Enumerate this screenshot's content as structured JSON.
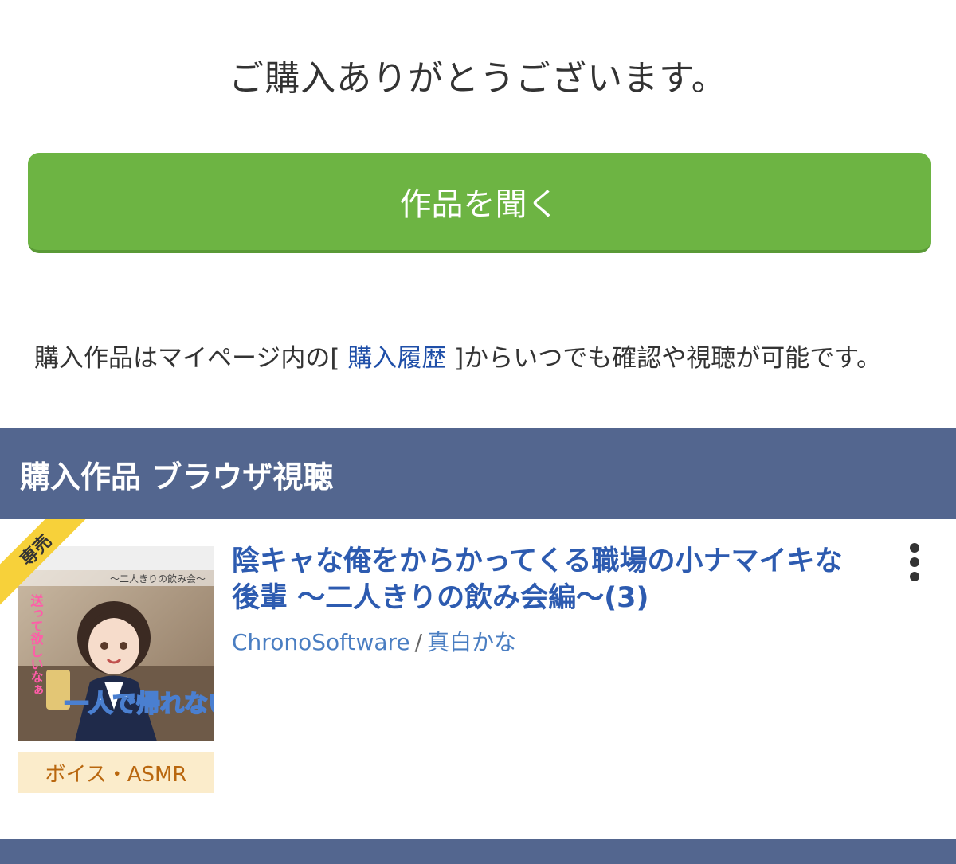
{
  "header": {
    "thanks_message": "ご購入ありがとうございます。"
  },
  "actions": {
    "listen_button_label": "作品を聞く"
  },
  "info": {
    "prefix": "購入作品はマイページ内の[ ",
    "link_label": "購入履歴",
    "suffix": " ]からいつでも確認や視聴が可能です。"
  },
  "section": {
    "title": "購入作品 ブラウザ視聴"
  },
  "work": {
    "exclusive_badge": "専売",
    "thumbnail_texts": {
      "top_caption": "〜二人きりの飲み会〜",
      "vertical_caption": "送って欲しいなぁ",
      "main_caption": "一人で帰れない"
    },
    "category": "ボイス・ASMR",
    "title": "陰キャな俺をからかってくる職場の小ナマイキな後輩 〜二人きりの飲み会編〜(3)",
    "circle": "ChronoSoftware",
    "separator": "/",
    "voice_actor": "真白かな"
  },
  "colors": {
    "button_green": "#6db443",
    "section_bar": "#53668f",
    "title_link": "#2d5bb0",
    "badge_yellow": "#f7d13a",
    "category_bg": "#fbeccb",
    "category_text": "#b9670f"
  },
  "icons": {
    "more": "more-vertical-icon"
  }
}
